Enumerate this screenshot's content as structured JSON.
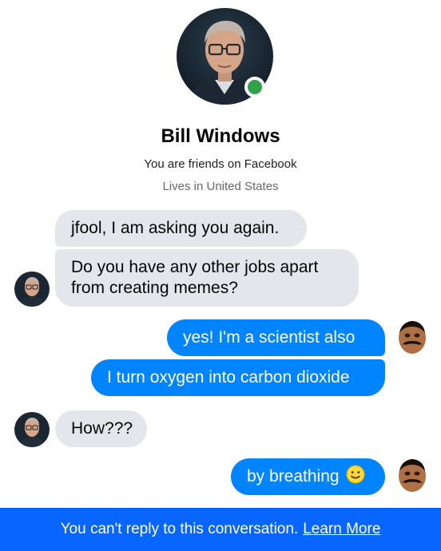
{
  "profile": {
    "name": "Bill Windows",
    "friends_text": "You are friends on Facebook",
    "lives_text": "Lives in United States"
  },
  "messages": [
    {
      "from": "them",
      "text": "jfool, I am asking you again."
    },
    {
      "from": "them",
      "text": "Do you have any other jobs apart from creating memes?",
      "lines": [
        "Do you have any other jobs apart",
        "from creating memes?"
      ]
    },
    {
      "from": "me",
      "text": "yes! I'm a scientist also"
    },
    {
      "from": "me",
      "text": "I turn oxygen into carbon dioxide"
    },
    {
      "from": "them",
      "text": "How???"
    },
    {
      "from": "me",
      "text": "by breathing",
      "emoji": "slightly-smiling-face-icon"
    }
  ],
  "footer": {
    "text": "You can't reply to this conversation.",
    "link": "Learn More"
  },
  "colors": {
    "outgoing_bubble": "#0084ff",
    "incoming_bubble": "#e4e6eb",
    "footer_bar": "#0866ff",
    "online": "#31a24c"
  }
}
